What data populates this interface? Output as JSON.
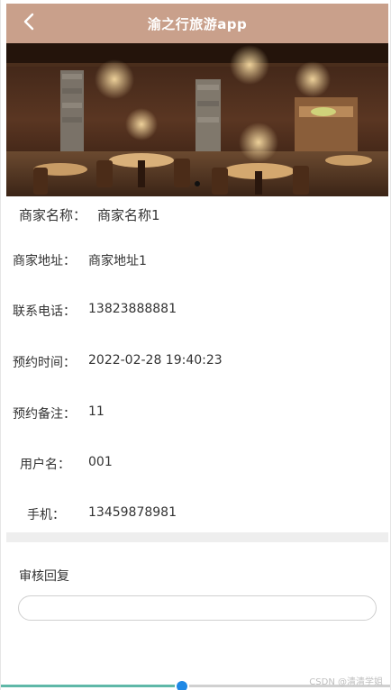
{
  "header": {
    "title": "渝之行旅游app",
    "back_icon": "chevron-left-icon",
    "background_color": "#c9a08b"
  },
  "merchant": {
    "name_label": "商家名称：",
    "name_value": "商家名称1"
  },
  "fields": [
    {
      "label": "商家地址：",
      "value": "商家地址1"
    },
    {
      "label": "联系电话：",
      "value": "13823888881"
    },
    {
      "label": "预约时间：",
      "value": "2022-02-28 19:40:23"
    },
    {
      "label": "预约备注：",
      "value": "11"
    },
    {
      "label": "用户名：",
      "value": "001"
    },
    {
      "label": "手机：",
      "value": "13459878981"
    }
  ],
  "review": {
    "label": "审核回复",
    "input_value": "",
    "placeholder": ""
  },
  "watermark": "CSDN @清清学姐"
}
